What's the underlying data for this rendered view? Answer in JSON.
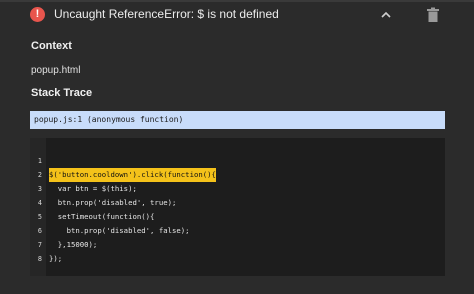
{
  "header": {
    "error_icon_glyph": "!",
    "error_title": "Uncaught ReferenceError: $ is not defined",
    "icons": [
      "error-icon",
      "chevron-up-icon",
      "trash-icon"
    ],
    "accent_color": "#e8554d"
  },
  "context": {
    "heading": "Context",
    "value": "popup.html"
  },
  "stack": {
    "heading": "Stack Trace",
    "frame": "popup.js:1 (anonymous function)",
    "frame_bg": "#c8dcfa"
  },
  "code": {
    "highlight_color": "#f4c21a",
    "lines": [
      {
        "num": "1",
        "text": "$('button.cooldown').click(function(){",
        "highlighted": true
      },
      {
        "num": "2",
        "text": "  var btn = $(this);",
        "highlighted": false
      },
      {
        "num": "3",
        "text": "  btn.prop('disabled', true);",
        "highlighted": false
      },
      {
        "num": "4",
        "text": "  setTimeout(function(){",
        "highlighted": false
      },
      {
        "num": "5",
        "text": "    btn.prop('disabled', false);",
        "highlighted": false
      },
      {
        "num": "6",
        "text": "  },15000);",
        "highlighted": false
      },
      {
        "num": "7",
        "text": "});",
        "highlighted": false
      },
      {
        "num": "8",
        "text": "",
        "highlighted": false
      }
    ]
  }
}
